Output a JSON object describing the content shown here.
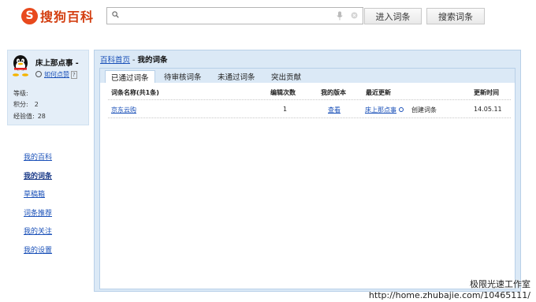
{
  "header": {
    "logo_glyph": "S",
    "logo_text": "搜狗百科",
    "search": {
      "value": "",
      "placeholder": ""
    },
    "enter_button": "进入词条",
    "search_button": "搜索词条"
  },
  "profile": {
    "name": "床上那点事 -",
    "link": "如何点赞",
    "help": "?",
    "level_label": "等级:",
    "level_value": "",
    "points_label": "积分:",
    "points_value": "2",
    "exp_label": "经验值:",
    "exp_value": "28"
  },
  "side_nav": {
    "items": [
      {
        "label": "我的百科"
      },
      {
        "label": "我的词条"
      },
      {
        "label": "草稿箱"
      },
      {
        "label": "词条推荐"
      },
      {
        "label": "我的关注"
      },
      {
        "label": "我的设置"
      }
    ]
  },
  "main": {
    "breadcrumb": {
      "home": "百科首页",
      "sep": " - ",
      "current": "我的词条"
    },
    "tabs": [
      {
        "label": "已通过词条",
        "active": true
      },
      {
        "label": "待审核词条",
        "active": false
      },
      {
        "label": "未通过词条",
        "active": false
      },
      {
        "label": "突出贡献",
        "active": false
      }
    ],
    "table": {
      "headers": {
        "name": "词条名称(共1条)",
        "edits": "编辑次数",
        "version": "我的版本",
        "latest": "最近更新",
        "time": "更新时间"
      },
      "rows": [
        {
          "name": "京东云购",
          "edits": "1",
          "version": "查看",
          "latest_user": "床上那点事",
          "latest_action": "创建词条",
          "time": "14.05.11"
        }
      ]
    }
  },
  "watermark": {
    "line1": "极限光速工作室",
    "line2": "http://home.zhubajie.com/10465111/"
  },
  "colors": {
    "brand": "#e8491d",
    "panel_bg": "#dbe9f6",
    "link": "#1a50b8"
  }
}
